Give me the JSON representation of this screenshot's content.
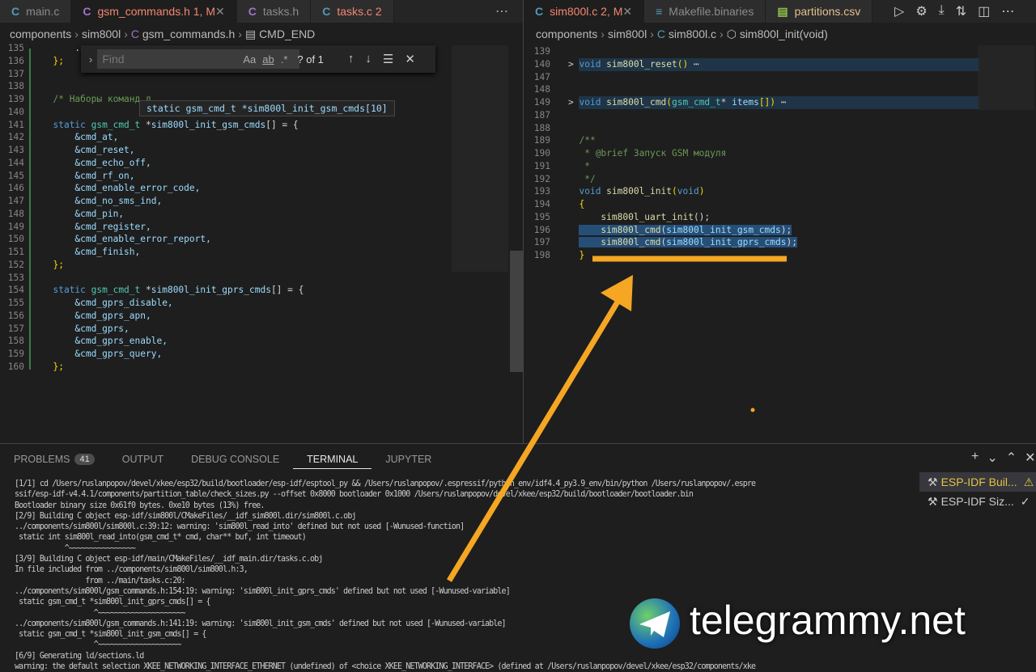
{
  "left_tabs": [
    {
      "label": "main.c",
      "icon": "C",
      "color": "blue"
    },
    {
      "label": "gsm_commands.h 1, M",
      "icon": "C",
      "color": "purple",
      "active": true,
      "modified": true
    },
    {
      "label": "tasks.h",
      "icon": "C",
      "color": "purple"
    },
    {
      "label": "tasks.c  2",
      "icon": "C",
      "color": "blue",
      "modified": true
    }
  ],
  "right_tabs": [
    {
      "label": "sim800l.c 2, M",
      "icon": "C",
      "active": true
    },
    {
      "label": "Makefile.binaries",
      "icon": "≡"
    },
    {
      "label": "partitions.csv",
      "icon": "▤"
    }
  ],
  "left_breadcrumb": [
    "components",
    "sim800l",
    "gsm_commands.h",
    "CMD_END"
  ],
  "right_breadcrumb": [
    "components",
    "sim800l",
    "sim800l.c",
    "sim800l_init(void)"
  ],
  "find": {
    "placeholder": "Find",
    "case": "Aa",
    "word": "ab",
    "regex": ".*",
    "result": "? of 1"
  },
  "hover": "static gsm_cmd_t *sim800l_init_gsm_cmds[10]",
  "left_code": [
    {
      "n": "135",
      "s": [
        [
          "    .ap",
          "tx"
        ]
      ]
    },
    {
      "n": "136",
      "s": [
        [
          "};",
          "pu"
        ]
      ]
    },
    {
      "n": "137",
      "s": []
    },
    {
      "n": "138",
      "s": []
    },
    {
      "n": "139",
      "s": [
        [
          "/* Наборы команд д",
          "cm"
        ]
      ]
    },
    {
      "n": "140",
      "s": []
    },
    {
      "n": "141",
      "s": [
        [
          "static ",
          "kw"
        ],
        [
          "gsm_cmd_t ",
          "ty"
        ],
        [
          "*",
          "tx"
        ],
        [
          "sim800l_init_gsm_cmds",
          "va"
        ],
        [
          "[] = {",
          "tx"
        ]
      ]
    },
    {
      "n": "142",
      "s": [
        [
          "    &cmd_at,",
          "va"
        ]
      ]
    },
    {
      "n": "143",
      "s": [
        [
          "    &cmd_reset,",
          "va"
        ]
      ]
    },
    {
      "n": "144",
      "s": [
        [
          "    &cmd_echo_off,",
          "va"
        ]
      ]
    },
    {
      "n": "145",
      "s": [
        [
          "    &cmd_rf_on,",
          "va"
        ]
      ]
    },
    {
      "n": "146",
      "s": [
        [
          "    &cmd_enable_error_code,",
          "va"
        ]
      ]
    },
    {
      "n": "147",
      "s": [
        [
          "    &cmd_no_sms_ind,",
          "va"
        ]
      ]
    },
    {
      "n": "148",
      "s": [
        [
          "    &cmd_pin,",
          "va"
        ]
      ]
    },
    {
      "n": "149",
      "s": [
        [
          "    &cmd_register,",
          "va"
        ]
      ]
    },
    {
      "n": "150",
      "s": [
        [
          "    &cmd_enable_error_report,",
          "va"
        ]
      ]
    },
    {
      "n": "151",
      "s": [
        [
          "    &cmd_finish,",
          "va"
        ]
      ]
    },
    {
      "n": "152",
      "s": [
        [
          "};",
          "pu"
        ]
      ]
    },
    {
      "n": "153",
      "s": []
    },
    {
      "n": "154",
      "s": [
        [
          "static ",
          "kw"
        ],
        [
          "gsm_cmd_t ",
          "ty"
        ],
        [
          "*",
          "tx"
        ],
        [
          "sim800l_init_gprs_cmds",
          "va"
        ],
        [
          "[] = {",
          "tx"
        ]
      ]
    },
    {
      "n": "155",
      "s": [
        [
          "    &cmd_gprs_disable,",
          "va"
        ]
      ]
    },
    {
      "n": "156",
      "s": [
        [
          "    &cmd_gprs_apn,",
          "va"
        ]
      ]
    },
    {
      "n": "157",
      "s": [
        [
          "    &cmd_gprs,",
          "va"
        ]
      ]
    },
    {
      "n": "158",
      "s": [
        [
          "    &cmd_gprs_enable,",
          "va"
        ]
      ]
    },
    {
      "n": "159",
      "s": [
        [
          "    &cmd_gprs_query,",
          "va"
        ]
      ]
    },
    {
      "n": "160",
      "s": [
        [
          "};",
          "pu"
        ]
      ]
    }
  ],
  "right_code": [
    {
      "n": "139",
      "s": []
    },
    {
      "n": "140",
      "s": [
        [
          "void ",
          "kw"
        ],
        [
          "sim800l_reset",
          "fn"
        ],
        [
          "()",
          "pu"
        ],
        [
          " ⋯",
          "tx"
        ]
      ],
      "fold": true
    },
    {
      "n": "147",
      "s": []
    },
    {
      "n": "148",
      "s": []
    },
    {
      "n": "149",
      "s": [
        [
          "void ",
          "kw"
        ],
        [
          "sim800l_cmd",
          "fn"
        ],
        [
          "(",
          "pu"
        ],
        [
          "gsm_cmd_t",
          "ty"
        ],
        [
          "* ",
          "tx"
        ],
        [
          "items",
          "va"
        ],
        [
          "[]",
          "pu"
        ],
        [
          ")",
          "pu"
        ],
        [
          " ⋯",
          "tx"
        ]
      ],
      "fold": true
    },
    {
      "n": "187",
      "s": []
    },
    {
      "n": "188",
      "s": []
    },
    {
      "n": "189",
      "s": [
        [
          "/**",
          "cm"
        ]
      ]
    },
    {
      "n": "190",
      "s": [
        [
          " * @brief Запуск GSM модуля",
          "cm"
        ]
      ]
    },
    {
      "n": "191",
      "s": [
        [
          " *",
          "cm"
        ]
      ]
    },
    {
      "n": "192",
      "s": [
        [
          " */",
          "cm"
        ]
      ]
    },
    {
      "n": "193",
      "s": [
        [
          "void ",
          "kw"
        ],
        [
          "sim800l_init",
          "fn"
        ],
        [
          "(",
          "pu"
        ],
        [
          "void",
          "kw"
        ],
        [
          ")",
          "pu"
        ]
      ]
    },
    {
      "n": "194",
      "s": [
        [
          "{",
          "pu"
        ]
      ]
    },
    {
      "n": "195",
      "s": [
        [
          "    sim800l_uart_init",
          "fn"
        ],
        [
          "();",
          "tx"
        ]
      ]
    },
    {
      "n": "196",
      "s": [
        [
          "    sim800l_cmd",
          "fn"
        ],
        [
          "(",
          "tx"
        ],
        [
          "sim800l_init_gsm_cmds",
          "va"
        ],
        [
          ");",
          "tx"
        ]
      ],
      "hl": true
    },
    {
      "n": "197",
      "s": [
        [
          "    sim800l_cmd",
          "fn"
        ],
        [
          "(",
          "tx"
        ],
        [
          "sim800l_init_gprs_cmds",
          "va"
        ],
        [
          ");",
          "tx"
        ]
      ],
      "hl": true
    },
    {
      "n": "198",
      "s": [
        [
          "}",
          "pu"
        ]
      ]
    }
  ],
  "panel": {
    "tabs": [
      "PROBLEMS",
      "OUTPUT",
      "DEBUG CONSOLE",
      "TERMINAL",
      "JUPYTER"
    ],
    "problems_count": "41",
    "active": "TERMINAL"
  },
  "terminal": [
    "[1/1] cd /Users/ruslanpopov/devel/xkee/esp32/build/bootloader/esp-idf/esptool_py && /Users/ruslanpopov/.espressif/python_env/idf4.4_py3.9_env/bin/python /Users/ruslanpopov/.espre",
    "ssif/esp-idf-v4.4.1/components/partition_table/check_sizes.py --offset 0x8000 bootloader 0x1000 /Users/ruslanpopov/devel/xkee/esp32/build/bootloader/bootloader.bin",
    "Bootloader binary size 0x61f0 bytes. 0xe10 bytes (13%) free.",
    "[2/9] Building C object esp-idf/sim800l/CMakeFiles/__idf_sim800l.dir/sim800l.c.obj",
    "../components/sim800l/sim800l.c:39:12: warning: 'sim800l_read_into' defined but not used [-Wunused-function]",
    " static int sim800l_read_into(gsm_cmd_t* cmd, char** buf, int timeout)",
    "            ^~~~~~~~~~~~~~~~~",
    "[3/9] Building C object esp-idf/main/CMakeFiles/__idf_main.dir/tasks.c.obj",
    "In file included from ../components/sim800l/sim800l.h:3,",
    "                 from ../main/tasks.c:20:",
    "../components/sim800l/gsm_commands.h:154:19: warning: 'sim800l_init_gprs_cmds' defined but not used [-Wunused-variable]",
    " static gsm_cmd_t *sim800l_init_gprs_cmds[] = {",
    "                   ^~~~~~~~~~~~~~~~~~~~~~",
    "../components/sim800l/gsm_commands.h:141:19: warning: 'sim800l_init_gsm_cmds' defined but not used [-Wunused-variable]",
    " static gsm_cmd_t *sim800l_init_gsm_cmds[] = {",
    "                   ^~~~~~~~~~~~~~~~~~~~~",
    "[6/9] Generating ld/sections.ld",
    "warning: the default selection XKEE_NETWORKING_INTERFACE_ETHERNET (undefined) of <choice XKEE_NETWORKING_INTERFACE> (defined at /Users/ruslanpopov/devel/xkee/esp32/components/xke"
  ],
  "terminal_list": [
    {
      "label": "ESP-IDF Buil...",
      "status": "⚠"
    },
    {
      "label": "ESP-IDF Siz...",
      "status": "✓"
    }
  ],
  "watermark": "telegrammy.net",
  "colors": {
    "accent": "#f5a623"
  }
}
